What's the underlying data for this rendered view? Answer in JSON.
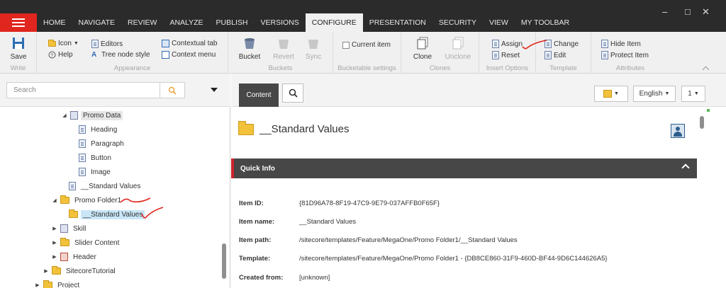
{
  "tabs": [
    {
      "label": "HOME"
    },
    {
      "label": "NAVIGATE"
    },
    {
      "label": "REVIEW"
    },
    {
      "label": "ANALYZE"
    },
    {
      "label": "PUBLISH"
    },
    {
      "label": "VERSIONS"
    },
    {
      "label": "CONFIGURE"
    },
    {
      "label": "PRESENTATION"
    },
    {
      "label": "SECURITY"
    },
    {
      "label": "VIEW"
    },
    {
      "label": "MY TOOLBAR"
    }
  ],
  "window": {
    "minimize": "–",
    "restore": "□",
    "close": "✕"
  },
  "ribbon": {
    "write": {
      "title": "Write",
      "save": "Save"
    },
    "appearance": {
      "title": "Appearance",
      "icon": "Icon",
      "help": "Help",
      "editors": "Editors",
      "tree_node_style": "Tree node style",
      "contextual_tab": "Contextual tab",
      "context_menu": "Context menu"
    },
    "buckets": {
      "title": "Buckets",
      "bucket": "Bucket",
      "revert": "Revert",
      "sync": "Sync"
    },
    "bucketable": {
      "title": "Bucketable settings",
      "current_item": "Current item"
    },
    "clones": {
      "title": "Clones",
      "clone": "Clone",
      "unclone": "Unclone"
    },
    "insert_options": {
      "title": "Insert Options",
      "assign": "Assign",
      "reset": "Reset"
    },
    "template": {
      "title": "Template",
      "change": "Change",
      "edit": "Edit"
    },
    "attributes": {
      "title": "Attributes",
      "hide_item": "Hide Item",
      "protect_item": "Protect Item"
    }
  },
  "search": {
    "placeholder": "Search"
  },
  "tree": [
    {
      "label": "Promo Data"
    },
    {
      "label": "Heading"
    },
    {
      "label": "Paragraph"
    },
    {
      "label": "Button"
    },
    {
      "label": "Image"
    },
    {
      "label": "__Standard Values"
    },
    {
      "label": "Promo Folder1"
    },
    {
      "label": "__Standard Values"
    },
    {
      "label": "Skill"
    },
    {
      "label": "Slider Content"
    },
    {
      "label": "Header"
    },
    {
      "label": "SitecoreTutorial"
    },
    {
      "label": "Project"
    }
  ],
  "content": {
    "tab_label": "Content",
    "language": "English",
    "version": "1",
    "title": "__Standard Values",
    "quick_info": "Quick Info",
    "fields": [
      {
        "label": "Item ID:",
        "value": "{81D96A78-8F19-47C9-9E79-037AFFB0F65F}"
      },
      {
        "label": "Item name:",
        "value": "__Standard Values"
      },
      {
        "label": "Item path:",
        "value": "/sitecore/templates/Feature/MegaOne/Promo Folder1/__Standard Values"
      },
      {
        "label": "Template:",
        "value": "/sitecore/templates/Feature/MegaOne/Promo Folder1 - {DB8CE860-31F9-460D-BF44-9D6C144626A5}"
      },
      {
        "label": "Created from:",
        "value": "[unknown]"
      }
    ]
  }
}
